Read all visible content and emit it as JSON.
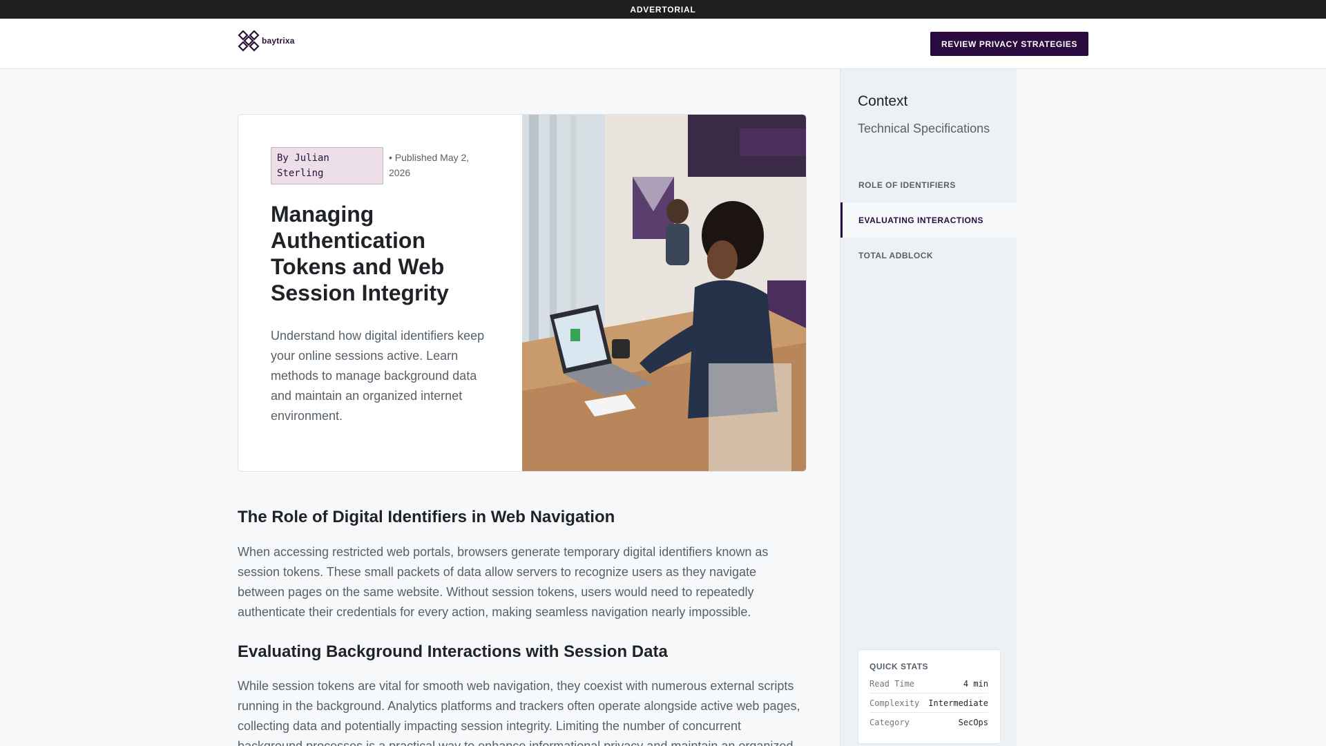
{
  "topbar": {
    "label": "ADVERTORIAL"
  },
  "header": {
    "logo_text": "baytrixa",
    "cta_label": "REVIEW PRIVACY STRATEGIES"
  },
  "hero": {
    "author": "By Julian Sterling",
    "published": "• Published May 2, 2026",
    "title": "Managing Authentication Tokens and Web Session Integrity",
    "summary": "Understand how digital identifiers keep your online sessions active. Learn methods to manage background data and maintain an organized internet environment."
  },
  "article": {
    "sections": [
      {
        "heading": "The Role of Digital Identifiers in Web Navigation",
        "body": "When accessing restricted web portals, browsers generate temporary digital identifiers known as session tokens. These small packets of data allow servers to recognize users as they navigate between pages on the same website. Without session tokens, users would need to repeatedly authenticate their credentials for every action, making seamless navigation nearly impossible."
      },
      {
        "heading": "Evaluating Background Interactions with Session Data",
        "body": "While session tokens are vital for smooth web navigation, they coexist with numerous external scripts running in the background. Analytics platforms and trackers often operate alongside active web pages, collecting data and potentially impacting session integrity. Limiting the number of concurrent background processes is a practical way to enhance informational privacy and maintain an organized"
      }
    ]
  },
  "sidebar": {
    "title": "Context",
    "subtitle": "Technical Specifications",
    "nav": [
      {
        "label": "ROLE OF IDENTIFIERS",
        "active": false
      },
      {
        "label": "EVALUATING INTERACTIONS",
        "active": true
      },
      {
        "label": "TOTAL ADBLOCK",
        "active": false
      }
    ],
    "stats": {
      "title": "QUICK STATS",
      "rows": [
        {
          "label": "Read Time",
          "value": "4 min"
        },
        {
          "label": "Complexity",
          "value": "Intermediate"
        },
        {
          "label": "Category",
          "value": "SecOps"
        }
      ]
    }
  },
  "colors": {
    "brand": "#2a0b3f",
    "topbar": "#1e1e1e",
    "author_badge": "#ecdfe8"
  }
}
